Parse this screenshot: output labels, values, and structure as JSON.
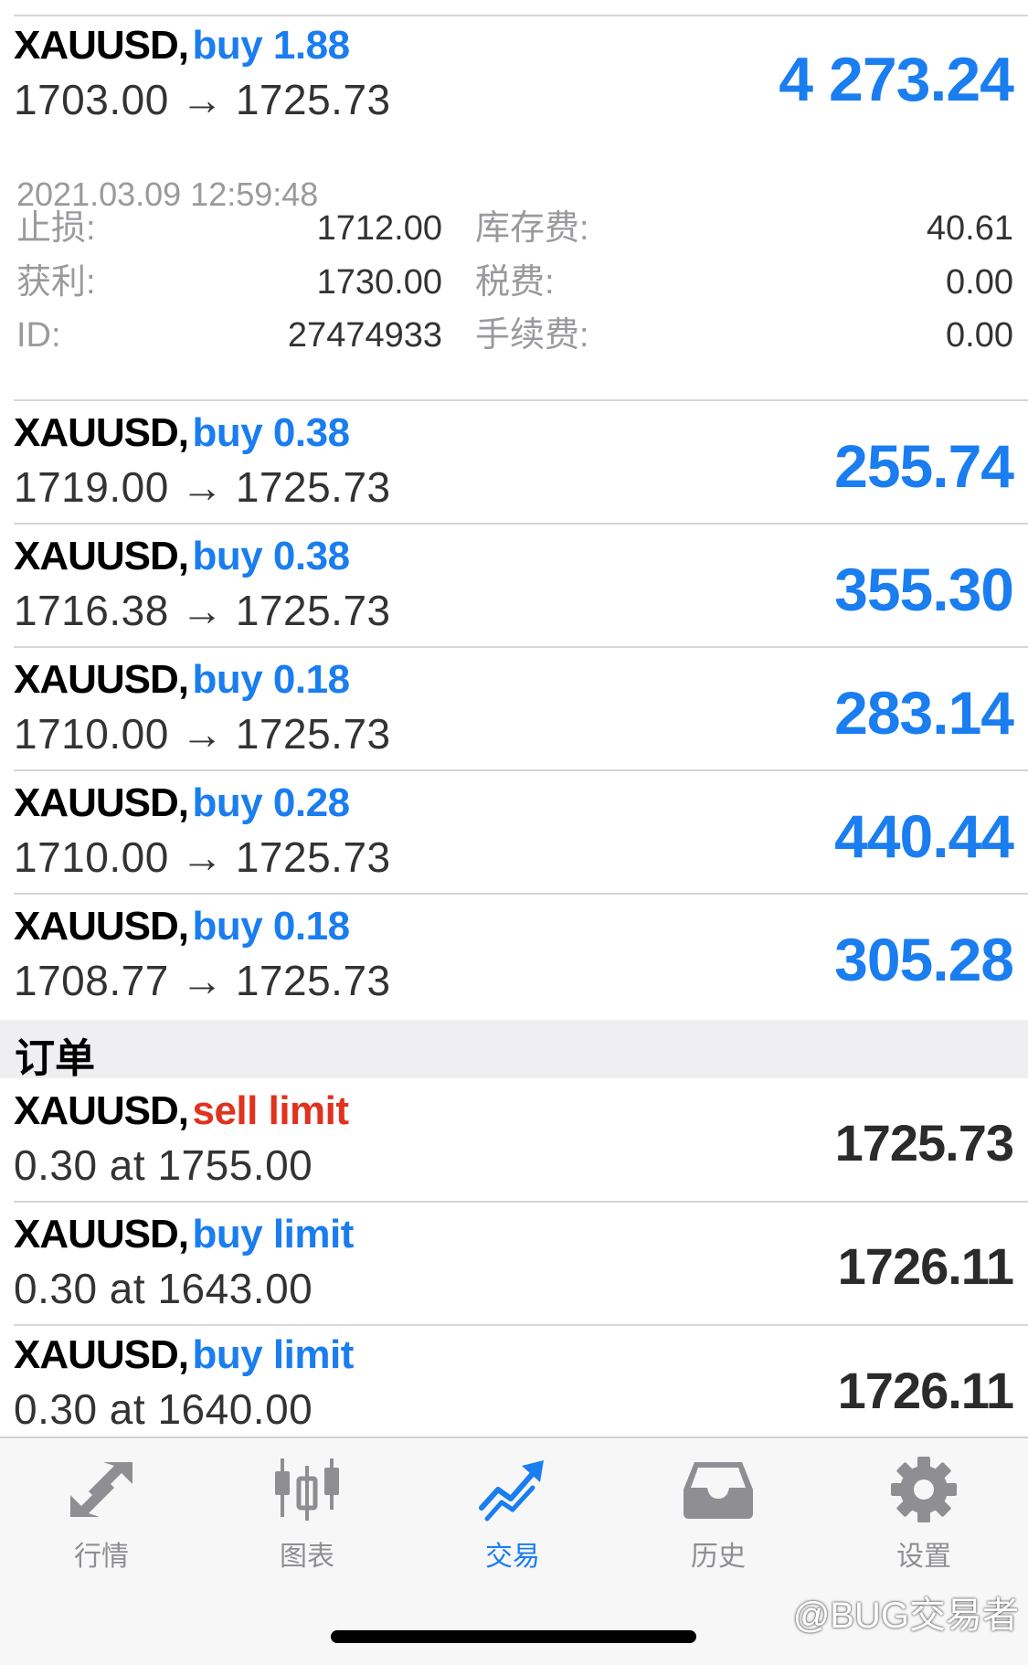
{
  "positions": [
    {
      "symbol": "XAUUSD,",
      "side": "buy 1.88",
      "open_price": "1703.00",
      "arrow": "→",
      "current_price": "1725.73",
      "profit": "4 273.24"
    },
    {
      "symbol": "XAUUSD,",
      "side": "buy 0.38",
      "open_price": "1719.00",
      "arrow": "→",
      "current_price": "1725.73",
      "profit": "255.74"
    },
    {
      "symbol": "XAUUSD,",
      "side": "buy 0.38",
      "open_price": "1716.38",
      "arrow": "→",
      "current_price": "1725.73",
      "profit": "355.30"
    },
    {
      "symbol": "XAUUSD,",
      "side": "buy 0.18",
      "open_price": "1710.00",
      "arrow": "→",
      "current_price": "1725.73",
      "profit": "283.14"
    },
    {
      "symbol": "XAUUSD,",
      "side": "buy 0.28",
      "open_price": "1710.00",
      "arrow": "→",
      "current_price": "1725.73",
      "profit": "440.44"
    },
    {
      "symbol": "XAUUSD,",
      "side": "buy 0.18",
      "open_price": "1708.77",
      "arrow": "→",
      "current_price": "1725.73",
      "profit": "305.28"
    }
  ],
  "expanded": {
    "timestamp": "2021.03.09 12:59:48",
    "stop_loss_label": "止损:",
    "stop_loss": "1712.00",
    "take_profit_label": "获利:",
    "take_profit": "1730.00",
    "id_label": "ID:",
    "id": "27474933",
    "swap_label": "库存费:",
    "swap": "40.61",
    "tax_label": "税费:",
    "tax": "0.00",
    "commission_label": "手续费:",
    "commission": "0.00"
  },
  "orders_section": {
    "title": "订单"
  },
  "orders": [
    {
      "symbol": "XAUUSD,",
      "type": "sell limit",
      "detail": "0.30 at 1755.00",
      "price": "1725.73"
    },
    {
      "symbol": "XAUUSD,",
      "type": "buy limit",
      "detail": "0.30 at 1643.00",
      "price": "1726.11"
    },
    {
      "symbol": "XAUUSD,",
      "type": "buy limit",
      "detail": "0.30 at 1640.00",
      "price": "1726.11"
    }
  ],
  "tabbar": {
    "quotes": "行情",
    "chart": "图表",
    "trade": "交易",
    "history": "历史",
    "settings": "设置"
  },
  "watermark": "@BUG交易者",
  "colors": {
    "accent_blue": "#1a7df0",
    "sell_red": "#e0321e",
    "inactive_gray": "#8e8e93"
  }
}
